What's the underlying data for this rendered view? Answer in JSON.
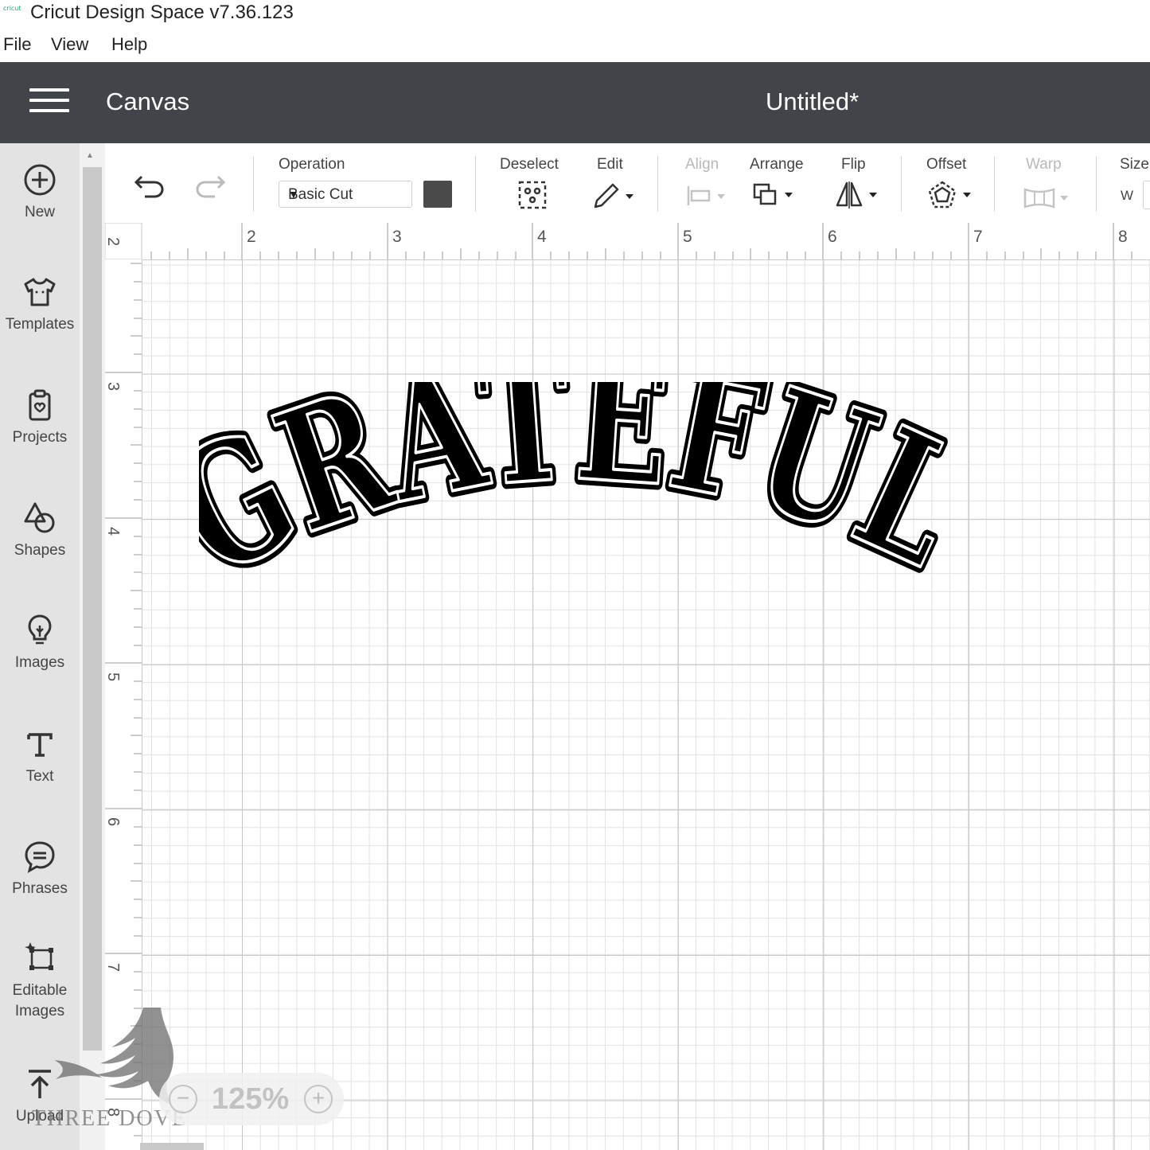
{
  "window": {
    "logo_text": "cricut",
    "title": "Cricut Design Space  v7.36.123"
  },
  "menu": {
    "items": [
      "File",
      "View",
      "Help"
    ]
  },
  "header": {
    "section": "Canvas",
    "document_title": "Untitled*"
  },
  "sidebar": {
    "items": [
      {
        "label": "New",
        "icon": "plus-circle-icon"
      },
      {
        "label": "Templates",
        "icon": "tshirt-icon"
      },
      {
        "label": "Projects",
        "icon": "clipboard-heart-icon"
      },
      {
        "label": "Shapes",
        "icon": "shapes-icon"
      },
      {
        "label": "Images",
        "icon": "lightbulb-icon"
      },
      {
        "label": "Text",
        "icon": "text-t-icon"
      },
      {
        "label": "Phrases",
        "icon": "speech-bubble-icon"
      },
      {
        "label": "Editable",
        "label2": "Images",
        "icon": "editable-image-icon"
      },
      {
        "label": "Upload",
        "icon": "upload-arrow-icon"
      }
    ]
  },
  "toolbar": {
    "operation_label": "Operation",
    "operation_value": "Basic Cut",
    "operation_color": "#4a4a4a",
    "deselect_label": "Deselect",
    "edit_label": "Edit",
    "align_label": "Align",
    "arrange_label": "Arrange",
    "flip_label": "Flip",
    "offset_label": "Offset",
    "warp_label": "Warp",
    "size_label": "Size",
    "size_w": "W"
  },
  "rulers": {
    "top": [
      "2",
      "3",
      "4",
      "5",
      "6",
      "7",
      "8"
    ],
    "left": [
      "2",
      "3",
      "4",
      "5",
      "6",
      "7",
      "8"
    ]
  },
  "canvas": {
    "design_text": "GRATEFUL"
  },
  "zoom": {
    "value": "125%",
    "minus": "−",
    "plus": "+"
  },
  "watermark": {
    "text": "THREE DOVE"
  }
}
